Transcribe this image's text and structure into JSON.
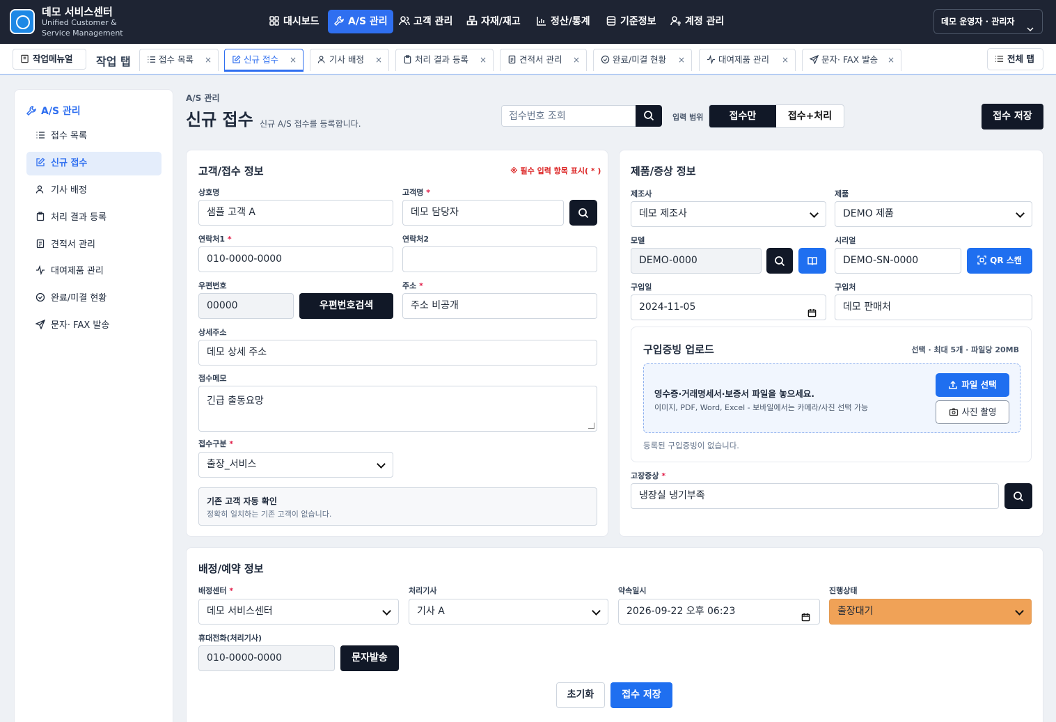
{
  "brand": {
    "title": "데모 서비스센터",
    "subtitle": "Unified Customer & Service Management"
  },
  "nav": [
    {
      "label": "대시보드",
      "icon": "grid-icon"
    },
    {
      "label": "A/S 관리",
      "icon": "wrench-icon",
      "active": true
    },
    {
      "label": "고객 관리",
      "icon": "users-icon"
    },
    {
      "label": "자재/재고",
      "icon": "boxes-icon"
    },
    {
      "label": "정산/통계",
      "icon": "chart-icon"
    },
    {
      "label": "기준정보",
      "icon": "database-icon"
    },
    {
      "label": "계정 관리",
      "icon": "user-key-icon"
    }
  ],
  "user": {
    "label": "데모 운영자 · 관리자"
  },
  "tabs_bar": {
    "memo_label": "작업메뉴얼",
    "title": "작업 탭",
    "all_label": "전체 탭",
    "tabs": [
      {
        "label": "접수 목록",
        "icon": "list-icon"
      },
      {
        "label": "신규 접수",
        "icon": "edit-icon",
        "active": true
      },
      {
        "label": "기사 배정",
        "icon": "user-icon"
      },
      {
        "label": "처리 결과 등록",
        "icon": "clipboard-icon"
      },
      {
        "label": "견적서 관리",
        "icon": "document-icon"
      },
      {
        "label": "완료/미결 현황",
        "icon": "check-circle-icon"
      },
      {
        "label": "대여제품 관리",
        "icon": "activity-icon"
      },
      {
        "label": "문자· FAX 발송",
        "icon": "send-icon"
      }
    ]
  },
  "sidebar": {
    "header": "A/S 관리",
    "items": [
      {
        "label": "접수 목록",
        "icon": "list-icon"
      },
      {
        "label": "신규 접수",
        "icon": "edit-icon",
        "active": true
      },
      {
        "label": "기사 배정",
        "icon": "user-icon"
      },
      {
        "label": "처리 결과 등록",
        "icon": "clipboard-icon"
      },
      {
        "label": "견적서 관리",
        "icon": "document-icon"
      },
      {
        "label": "대여제품 관리",
        "icon": "activity-icon"
      },
      {
        "label": "완료/미결 현황",
        "icon": "check-circle-icon"
      },
      {
        "label": "문자· FAX 발송",
        "icon": "send-icon"
      }
    ]
  },
  "header": {
    "breadcrumb": "A/S 관리",
    "title": "신규 접수",
    "desc": "신규 A/S 접수를 등록합니다.",
    "lookup_placeholder": "접수번호 조회",
    "range_label": "입력 범위",
    "range_a": "접수만",
    "range_b": "접수+처리",
    "save_label": "접수 저장"
  },
  "customer": {
    "title": "고객/접수 정보",
    "required_note": "※ 필수 입력 항목 표시( * )",
    "company_label": "상호명",
    "company_value": "샘플 고객 A",
    "name_label": "고객명",
    "name_value": "데모 담당자",
    "phone1_label": "연락처1",
    "phone1_value": "010-0000-0000",
    "phone2_label": "연락처2",
    "phone2_value": "",
    "zip_label": "우편번호",
    "zip_value": "00000",
    "zip_btn": "우편번호검색",
    "addr_label": "주소",
    "addr_value": "주소 비공개",
    "addr_detail_label": "상세주소",
    "addr_detail_value": "데모 상세 주소",
    "memo_label": "접수메모",
    "memo_value": "긴급 출동요망",
    "type_label": "접수구분",
    "type_value": "출장_서비스",
    "existing_title": "기존 고객 자동 확인",
    "existing_desc": "정확히 일치하는 기존 고객이 없습니다."
  },
  "product": {
    "title": "제품/증상 정보",
    "maker_label": "제조사",
    "maker_value": "데모 제조사",
    "product_label": "제품",
    "product_value": "DEMO 제품",
    "model_label": "모델",
    "model_value": "DEMO-0000",
    "serial_label": "시리얼",
    "serial_value": "DEMO-SN-0000",
    "qr_label": "QR 스캔",
    "buy_date_label": "구입일",
    "buy_date_value": "2024-11-05",
    "buy_place_label": "구입처",
    "buy_place_value": "데모 판매처",
    "upload_title": "구입증빙 업로드",
    "upload_limit": "선택 · 최대 5개 · 파일당 20MB",
    "drop_title": "영수증·거래명세서·보증서 파일을 놓으세요.",
    "drop_desc": "이미지, PDF, Word, Excel - 보바일에서는 카메라/사진 선택 가능",
    "file_btn": "파일 선택",
    "photo_btn": "사진 촬영",
    "no_files": "등록된 구입증빙이 없습니다.",
    "symptom_label": "고장증상",
    "symptom_value": "냉장실 냉기부족"
  },
  "dispatch": {
    "title": "배정/예약 정보",
    "center_label": "배정센터",
    "center_value": "데모 서비스센터",
    "tech_label": "처리기사",
    "tech_value": "기사 A",
    "appt_label": "약속일시",
    "appt_value": "2026-09-22 오후 06:23",
    "status_label": "진행상태",
    "status_value": "출장대기",
    "tech_phone_label": "휴대전화(처리기사)",
    "tech_phone_value": "010-0000-0000",
    "sms_btn": "문자발송"
  },
  "footer": {
    "reset_label": "초기화",
    "save_label": "접수 저장"
  },
  "colors": {
    "primary": "#2f6ff0",
    "dark": "#111827",
    "nav_bg": "#1e2433",
    "status_orange": "#f0a257",
    "required": "#e11d48"
  }
}
